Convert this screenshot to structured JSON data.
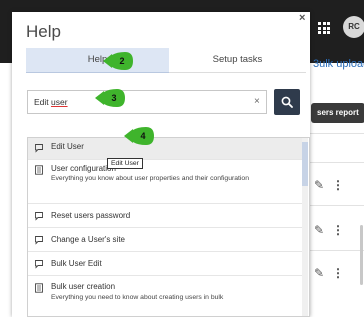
{
  "background": {
    "avatar_initials": "RC",
    "bulk_upload_link": "3ulk uploac",
    "users_report_button": "sers report"
  },
  "help": {
    "title": "Help",
    "close_label": "×",
    "tabs": [
      {
        "label": "Help",
        "active": true
      },
      {
        "label": "Setup tasks",
        "active": false
      }
    ],
    "search": {
      "value_prefix": "Edit ",
      "value_underlined": "user"
    },
    "tooltip": "Edit User",
    "results": [
      {
        "title": "Edit User",
        "description": "",
        "icon": "chat-bubble-icon"
      },
      {
        "title": "User configuration",
        "description": "Everything you know about user properties and their configuration",
        "icon": "document-icon"
      },
      {
        "title": "Reset users password",
        "description": "",
        "icon": "chat-bubble-icon"
      },
      {
        "title": "Change a User's site",
        "description": "",
        "icon": "chat-bubble-icon"
      },
      {
        "title": "Bulk User Edit",
        "description": "",
        "icon": "chat-bubble-icon"
      },
      {
        "title": "Bulk user creation",
        "description": "Everything you need to know about creating users in bulk",
        "icon": "document-icon"
      }
    ]
  },
  "callouts": [
    "2",
    "3",
    "4"
  ],
  "colors": {
    "callout_green": "#3fb42c",
    "search_button": "#2f3b4c",
    "active_tab": "#dde6f4",
    "topbar": "#1f1f1f"
  }
}
